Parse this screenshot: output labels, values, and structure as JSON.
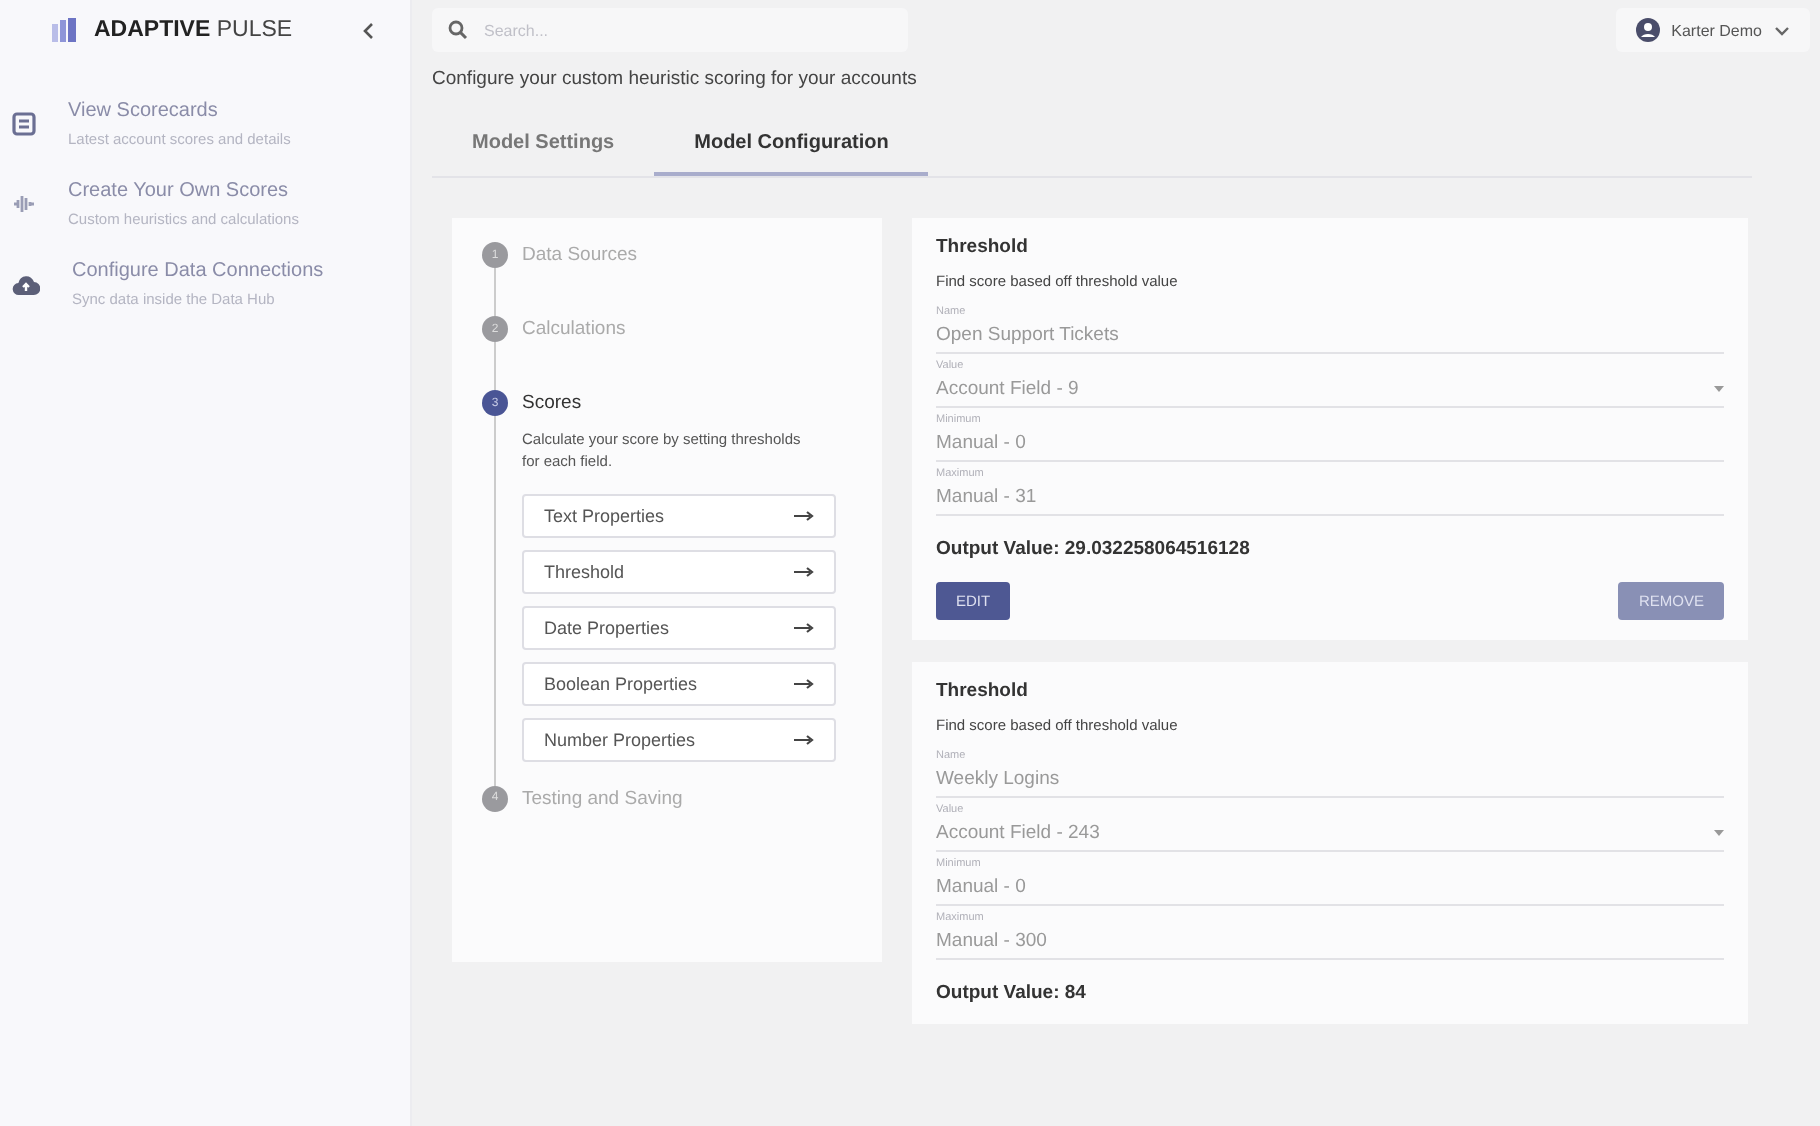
{
  "brand": {
    "bold": "ADAPTIVE",
    "light": "PULSE"
  },
  "sidebar": {
    "items": [
      {
        "title": "View Scorecards",
        "subtitle": "Latest account scores and details"
      },
      {
        "title": "Create Your Own Scores",
        "subtitle": "Custom heuristics and calculations"
      },
      {
        "title": "Configure Data Connections",
        "subtitle": "Sync data inside the Data Hub"
      }
    ]
  },
  "search": {
    "placeholder": "Search..."
  },
  "user": {
    "name": "Karter Demo"
  },
  "subtitle": "Configure your custom heuristic scoring for your accounts",
  "tabs": [
    {
      "label": "Model Settings",
      "selected": false
    },
    {
      "label": "Model Configuration",
      "selected": true
    }
  ],
  "steps": [
    {
      "number": "1",
      "label": "Data Sources",
      "selected": false
    },
    {
      "number": "2",
      "label": "Calculations",
      "selected": false
    },
    {
      "number": "3",
      "label": "Scores",
      "selected": true,
      "description": "Calculate your score by setting thresholds for each field.",
      "options": [
        "Text Properties",
        "Threshold",
        "Date Properties",
        "Boolean Properties",
        "Number Properties"
      ]
    },
    {
      "number": "4",
      "label": "Testing and Saving",
      "selected": false
    }
  ],
  "cards": [
    {
      "title": "Threshold",
      "description": "Find score based off threshold value",
      "fields": [
        {
          "kind": "text",
          "label": "Name",
          "value": "Open Support Tickets"
        },
        {
          "kind": "select",
          "label": "Value",
          "value": "Account Field - 9"
        },
        {
          "kind": "text",
          "label": "Minimum",
          "value": "Manual - 0"
        },
        {
          "kind": "text",
          "label": "Maximum",
          "value": "Manual - 31"
        }
      ],
      "output": "Output Value: 29.032258064516128",
      "buttons": [
        "EDIT",
        "REMOVE"
      ]
    },
    {
      "title": "Threshold",
      "description": "Find score based off threshold value",
      "fields": [
        {
          "kind": "text",
          "label": "Name",
          "value": "Weekly Logins"
        },
        {
          "kind": "select",
          "label": "Value",
          "value": "Account Field - 243"
        },
        {
          "kind": "text",
          "label": "Minimum",
          "value": "Manual - 0"
        },
        {
          "kind": "text",
          "label": "Maximum",
          "value": "Manual - 300"
        }
      ],
      "output": "Output Value: 84"
    }
  ]
}
